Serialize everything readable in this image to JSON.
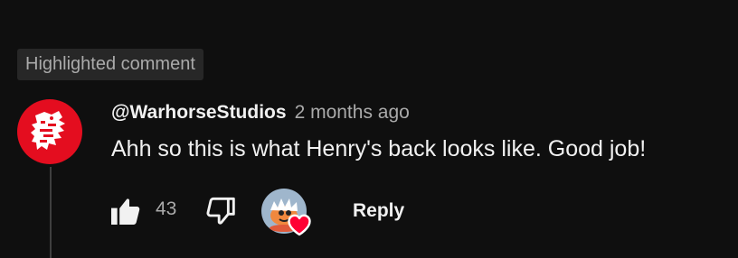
{
  "badge": {
    "label": "Highlighted comment"
  },
  "comment": {
    "author": "@WarhorseStudios",
    "timestamp": "2 months ago",
    "text": "Ahh so this is what Henry's back looks like. Good job!",
    "author_avatar_icon": "warhorse-logo",
    "accent_color": "#e40d1f"
  },
  "actions": {
    "like_icon": "thumbs-up-icon",
    "like_count": "43",
    "dislike_icon": "thumbs-down-icon",
    "creator_heart_icon": "creator-heart-icon",
    "heart_color": "#ff0033",
    "reply_label": "Reply"
  }
}
